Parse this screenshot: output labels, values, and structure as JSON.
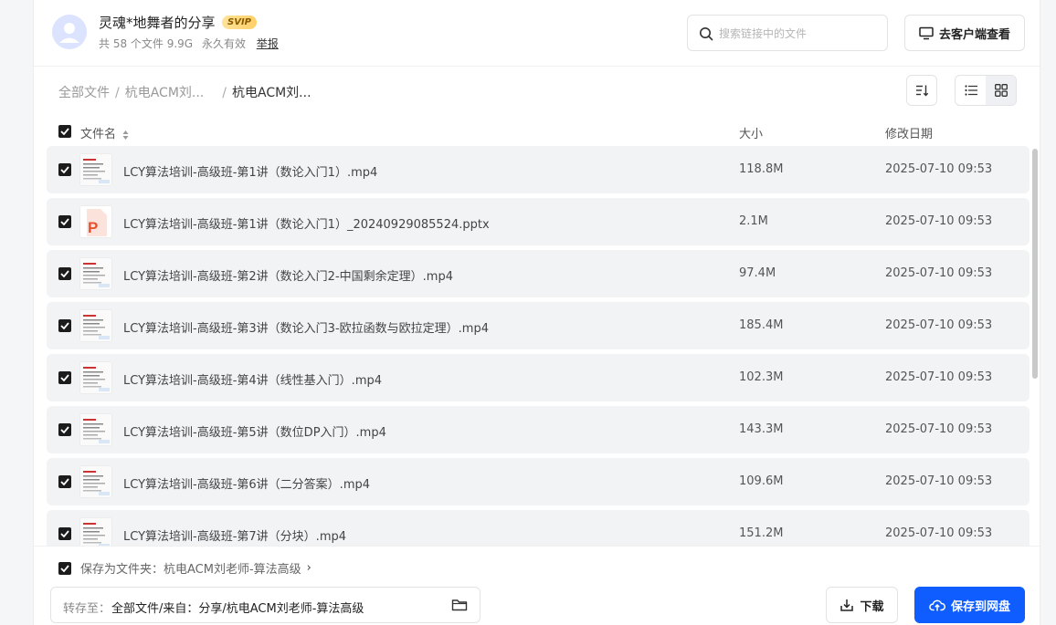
{
  "header": {
    "owner_name": "灵魂*地舞者的分享",
    "vip_badge": "SVIP",
    "file_count": "共 58 个文件 9.9G",
    "validity": "永久有效",
    "report_link": "举报",
    "search_placeholder": "搜索链接中的文件",
    "client_button": "去客户端查看"
  },
  "breadcrumb": {
    "root": "全部文件",
    "parent": "杭电ACM刘...",
    "current": "杭电ACM刘..."
  },
  "table": {
    "col_name": "文件名",
    "col_size": "大小",
    "col_date": "修改日期"
  },
  "files": [
    {
      "name": "LCY算法培训-高级班-第1讲（数论入门1）.mp4",
      "size": "118.8M",
      "date": "2025-07-10 09:53",
      "type": "video"
    },
    {
      "name": "LCY算法培训-高级班-第1讲（数论入门1）_20240929085524.pptx",
      "size": "2.1M",
      "date": "2025-07-10 09:53",
      "type": "ppt"
    },
    {
      "name": "LCY算法培训-高级班-第2讲（数论入门2-中国剩余定理）.mp4",
      "size": "97.4M",
      "date": "2025-07-10 09:53",
      "type": "video"
    },
    {
      "name": "LCY算法培训-高级班-第3讲（数论入门3-欧拉函数与欧拉定理）.mp4",
      "size": "185.4M",
      "date": "2025-07-10 09:53",
      "type": "video"
    },
    {
      "name": "LCY算法培训-高级班-第4讲（线性基入门）.mp4",
      "size": "102.3M",
      "date": "2025-07-10 09:53",
      "type": "video"
    },
    {
      "name": "LCY算法培训-高级班-第5讲（数位DP入门）.mp4",
      "size": "143.3M",
      "date": "2025-07-10 09:53",
      "type": "video"
    },
    {
      "name": "LCY算法培训-高级班-第6讲（二分答案）.mp4",
      "size": "109.6M",
      "date": "2025-07-10 09:53",
      "type": "video"
    },
    {
      "name": "LCY算法培训-高级班-第7讲（分块）.mp4",
      "size": "151.2M",
      "date": "2025-07-10 09:53",
      "type": "video"
    }
  ],
  "footer": {
    "save_as_folder": "保存为文件夹：杭电ACM刘老师-算法高级",
    "save_to_label": "转存至：",
    "save_to_path": "全部文件/来自：分享/杭电ACM刘老师-算法高级",
    "download_button": "下载",
    "save_button": "保存到网盘"
  },
  "colors": {
    "primary": "#0f5cff",
    "row_bg": "#f2f3f5",
    "checkbox": "#1c1c1c"
  }
}
